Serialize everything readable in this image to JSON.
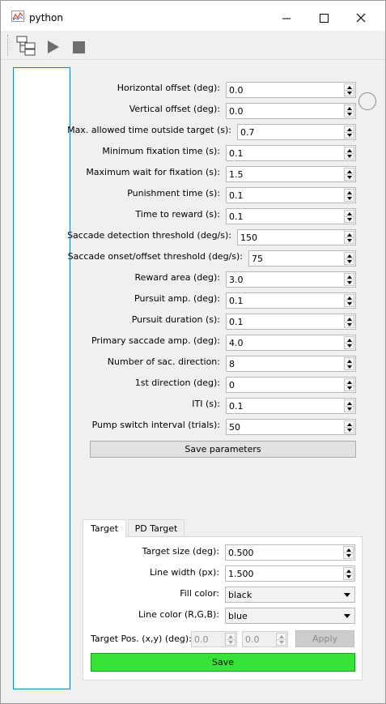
{
  "window": {
    "title": "python"
  },
  "toolbar": {
    "icons": [
      "workflow-icon",
      "play-icon",
      "stop-icon"
    ]
  },
  "params": [
    {
      "label": "Horizontal offset (deg):",
      "value": "0.0"
    },
    {
      "label": "Vertical offset (deg):",
      "value": "0.0"
    },
    {
      "label": "Max. allowed time outside target (s):",
      "value": "0.7"
    },
    {
      "label": "Minimum fixation time (s):",
      "value": "0.1"
    },
    {
      "label": "Maximum wait for fixation (s):",
      "value": "1.5"
    },
    {
      "label": "Punishment time (s):",
      "value": "0.1"
    },
    {
      "label": "Time to reward (s):",
      "value": "0.1"
    },
    {
      "label": "Saccade detection threshold (deg/s):",
      "value": "150"
    },
    {
      "label": "Saccade onset/offset threshold (deg/s):",
      "value": "75"
    },
    {
      "label": "Reward area (deg):",
      "value": "3.0"
    },
    {
      "label": "Pursuit amp. (deg):",
      "value": "0.1"
    },
    {
      "label": "Pursuit duration (s):",
      "value": "0.1"
    },
    {
      "label": "Primary saccade amp. (deg):",
      "value": "4.0"
    },
    {
      "label": "Number of sac. direction:",
      "value": "8"
    },
    {
      "label": "1st direction (deg):",
      "value": "0"
    },
    {
      "label": "ITI (s):",
      "value": "0.1"
    },
    {
      "label": "Pump switch interval (trials):",
      "value": "50"
    }
  ],
  "save_params_label": "Save parameters",
  "tabs": [
    "Target",
    "PD Target"
  ],
  "target": {
    "size_label": "Target size (deg):",
    "size_value": "0.500",
    "line_width_label": "Line width (px):",
    "line_width_value": "1.500",
    "fill_color_label": "Fill color:",
    "fill_color_value": "black",
    "line_color_label": "Line color (R,G,B):",
    "line_color_value": "blue",
    "pos_label": "Target Pos. (x,y) (deg):",
    "pos_x": "0.0",
    "pos_y": "0.0",
    "apply_label": "Apply",
    "save_label": "Save"
  },
  "colors": {
    "save_green": "#36e336",
    "sidebar_border": "#1e7fb0"
  }
}
